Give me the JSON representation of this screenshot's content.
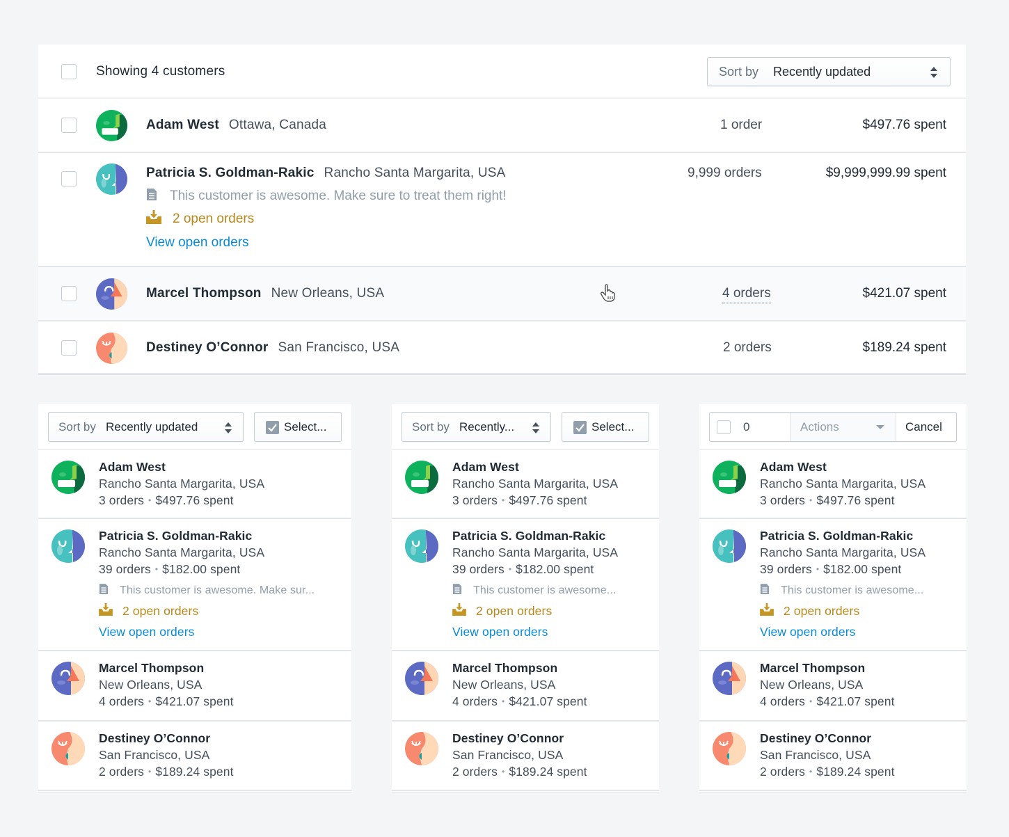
{
  "colors": {
    "background": "#f4f5f7",
    "card": "#ffffff",
    "text_primary": "#212b36",
    "text_secondary": "#454f5b",
    "text_subdued": "#919eab",
    "open_orders": "#b7881c",
    "link": "#0a8ad2"
  },
  "desktop": {
    "header": {
      "showing_text": "Showing 4 customers",
      "sort_label": "Sort by",
      "sort_value": "Recently updated"
    },
    "customers": [
      {
        "name": "Adam West",
        "location": "Ottawa, Canada",
        "orders": "1 order",
        "spent": "$497.76 spent",
        "avatar": "green-avatar"
      },
      {
        "name": "Patricia S. Goldman-Rakic",
        "location": "Rancho Santa Margarita, USA",
        "orders": "9,999 orders",
        "spent": "$9,999,999.99 spent",
        "note": "This customer is awesome. Make sure to treat them right!",
        "open_orders": "2 open orders",
        "link": "View open orders",
        "avatar": "teal-avatar"
      },
      {
        "name": "Marcel Thompson",
        "location": "New Orleans, USA",
        "orders": "4 orders",
        "spent": "$421.07 spent",
        "avatar": "indigo-avatar",
        "hovered": true
      },
      {
        "name": "Destiney O’Connor",
        "location": "San Francisco, USA",
        "orders": "2 orders",
        "spent": "$189.24 spent",
        "avatar": "coral-avatar"
      }
    ]
  },
  "mobile": [
    {
      "toolbar": {
        "sort_label": "Sort by",
        "sort_value": "Recently updated",
        "select_label": "Select..."
      },
      "note_text": "This customer is awesome. Make sur..."
    },
    {
      "toolbar": {
        "sort_label": "Sort by",
        "sort_value": "Recently...",
        "select_label": "Select..."
      },
      "note_text": "This customer is awesome..."
    },
    {
      "toolbar": {
        "selected_count": "0",
        "actions_label": "Actions",
        "cancel_label": "Cancel"
      },
      "note_text": "This customer is awesome..."
    }
  ],
  "mobile_customers": [
    {
      "name": "Adam West",
      "location": "Rancho Santa Margarita, USA",
      "orders": "3 orders",
      "spent": "$497.76 spent"
    },
    {
      "name": "Patricia S. Goldman-Rakic",
      "location": "Rancho Santa Margarita, USA",
      "orders": "39 orders",
      "spent": "$182.00 spent",
      "open_orders": "2 open orders",
      "link": "View open orders"
    },
    {
      "name": "Marcel Thompson",
      "location": "New Orleans, USA",
      "orders": "4 orders",
      "spent": "$421.07 spent"
    },
    {
      "name": "Destiney O’Connor",
      "location": "San Francisco, USA",
      "orders": "2 orders",
      "spent": "$189.24 spent"
    }
  ],
  "separator": "•"
}
